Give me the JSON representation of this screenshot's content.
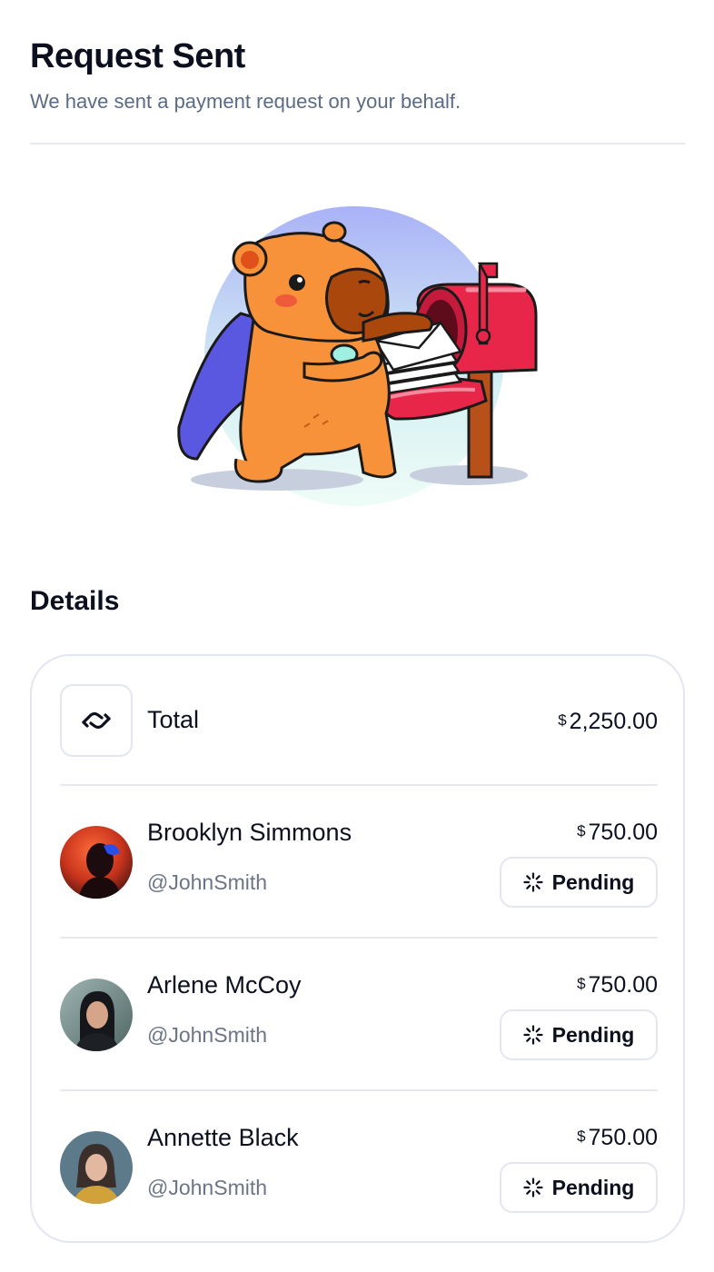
{
  "header": {
    "title": "Request Sent",
    "subtitle": "We have sent a payment request on your behalf."
  },
  "details": {
    "title": "Details",
    "total": {
      "label": "Total",
      "currency": "$",
      "amount": "2,250.00",
      "icon": "handshake-icon"
    },
    "people": [
      {
        "name": "Brooklyn Simmons",
        "handle": "@JohnSmith",
        "currency": "$",
        "amount": "750.00",
        "status": "Pending",
        "status_icon": "loader-icon"
      },
      {
        "name": "Arlene McCoy",
        "handle": "@JohnSmith",
        "currency": "$",
        "amount": "750.00",
        "status": "Pending",
        "status_icon": "loader-icon"
      },
      {
        "name": "Annette Black",
        "handle": "@JohnSmith",
        "currency": "$",
        "amount": "750.00",
        "status": "Pending",
        "status_icon": "loader-icon"
      }
    ]
  },
  "colors": {
    "text_primary": "#0b0f1e",
    "text_secondary": "#5b6b83",
    "border": "#e3e6f1",
    "mailbox_red": "#e8264a",
    "capybara_orange": "#f7923a",
    "cape_purple": "#5a57e0"
  }
}
